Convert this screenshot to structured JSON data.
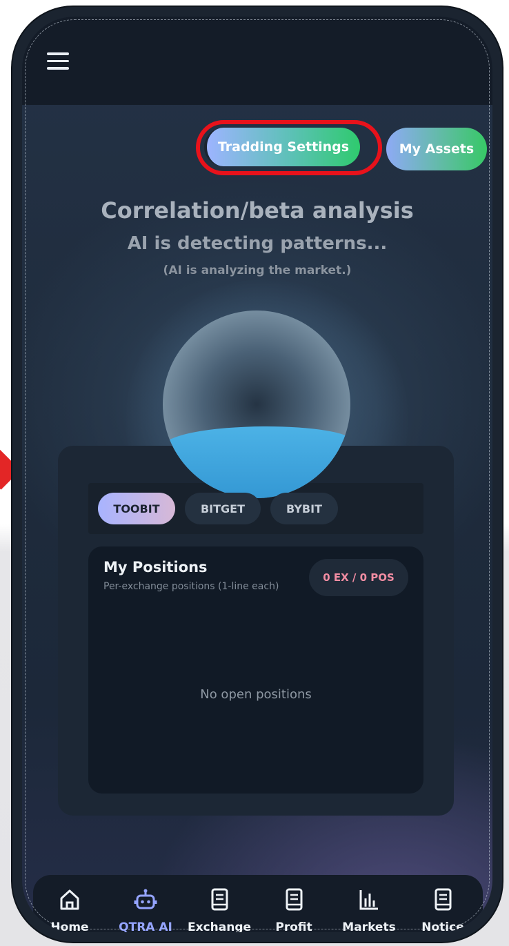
{
  "header": {
    "menu_icon": "hamburger-icon"
  },
  "actions": {
    "trading_settings_label": "Tradding Settings",
    "my_assets_label": "My Assets"
  },
  "analysis": {
    "title": "Correlation/beta analysis",
    "subtitle": "AI is detecting patterns...",
    "note": "(AI is analyzing the market.)"
  },
  "exchanges": {
    "tabs": [
      "TOOBIT",
      "BITGET",
      "BYBIT"
    ],
    "selected": "TOOBIT"
  },
  "positions": {
    "title": "My Positions",
    "subtitle": "Per-exchange positions (1-line each)",
    "badge": "0 EX / 0 POS",
    "empty_text": "No open positions"
  },
  "nav": {
    "active": "QTRA AI",
    "items": [
      {
        "label": "Home",
        "icon": "home-icon"
      },
      {
        "label": "QTRA AI",
        "icon": "robot-icon"
      },
      {
        "label": "Exchange",
        "icon": "book-icon"
      },
      {
        "label": "Profit",
        "icon": "book-icon"
      },
      {
        "label": "Markets",
        "icon": "bar-chart-icon"
      },
      {
        "label": "Notice",
        "icon": "book-icon"
      }
    ]
  },
  "colors": {
    "highlight_ring": "#e8121b",
    "accent_active": "#95a4ff",
    "badge_text": "#f28da3"
  }
}
